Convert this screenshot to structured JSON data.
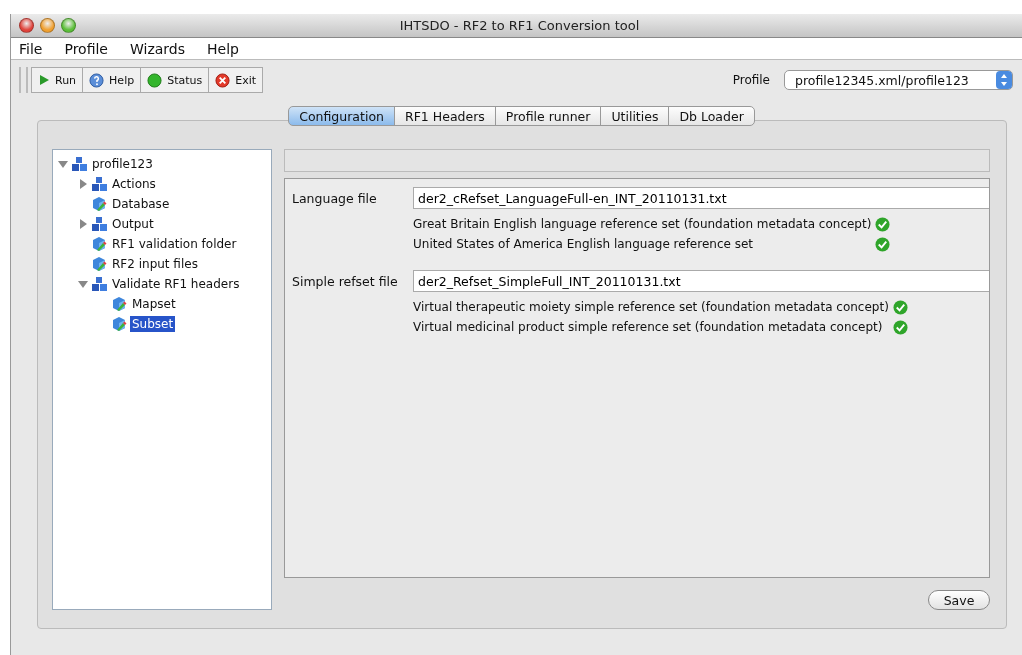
{
  "window": {
    "title": "IHTSDO - RF2 to RF1 Conversion tool"
  },
  "menu": [
    "File",
    "Profile",
    "Wizards",
    "Help"
  ],
  "toolbar": [
    {
      "kind": "run",
      "label": "Run"
    },
    {
      "kind": "help",
      "label": "Help"
    },
    {
      "kind": "status",
      "label": "Status"
    },
    {
      "kind": "exit",
      "label": "Exit"
    }
  ],
  "profile": {
    "label": "Profile",
    "value": "profile12345.xml/profile123"
  },
  "tabs": [
    {
      "label": "Configuration",
      "selected": true
    },
    {
      "label": "RF1 Headers",
      "selected": false
    },
    {
      "label": "Profile runner",
      "selected": false
    },
    {
      "label": "Utilities",
      "selected": false
    },
    {
      "label": "Db Loader",
      "selected": false
    }
  ],
  "tree": [
    {
      "label": "profile123",
      "kind": "group",
      "expanded": true,
      "selected": false,
      "children": [
        {
          "label": "Actions",
          "kind": "group",
          "expanded": false,
          "selected": false
        },
        {
          "label": "Database",
          "kind": "leaf",
          "selected": false
        },
        {
          "label": "Output",
          "kind": "group",
          "expanded": false,
          "selected": false
        },
        {
          "label": "RF1 validation folder",
          "kind": "leaf",
          "selected": false
        },
        {
          "label": "RF2 input files",
          "kind": "leaf",
          "selected": false
        },
        {
          "label": "Validate RF1 headers",
          "kind": "group",
          "expanded": true,
          "selected": false,
          "children": [
            {
              "label": "Mapset",
              "kind": "leaf",
              "selected": false
            },
            {
              "label": "Subset",
              "kind": "leaf",
              "selected": true
            }
          ]
        }
      ]
    }
  ],
  "files": [
    {
      "label": "Language file",
      "value": "der2_cRefset_LanguageFull-en_INT_20110131.txt",
      "refsets": [
        {
          "name": "Great Britain English language reference set (foundation metadata concept)",
          "valid": true
        },
        {
          "name": "United States of America English language reference set",
          "valid": true
        }
      ]
    },
    {
      "label": "Simple refset file",
      "value": "der2_Refset_SimpleFull_INT_20110131.txt",
      "refsets": [
        {
          "name": "Virtual therapeutic moiety simple reference set (foundation metadata concept)",
          "valid": true
        },
        {
          "name": "Virtual medicinal product simple reference set (foundation metadata concept)",
          "valid": true
        }
      ]
    }
  ],
  "save_button": "Save"
}
